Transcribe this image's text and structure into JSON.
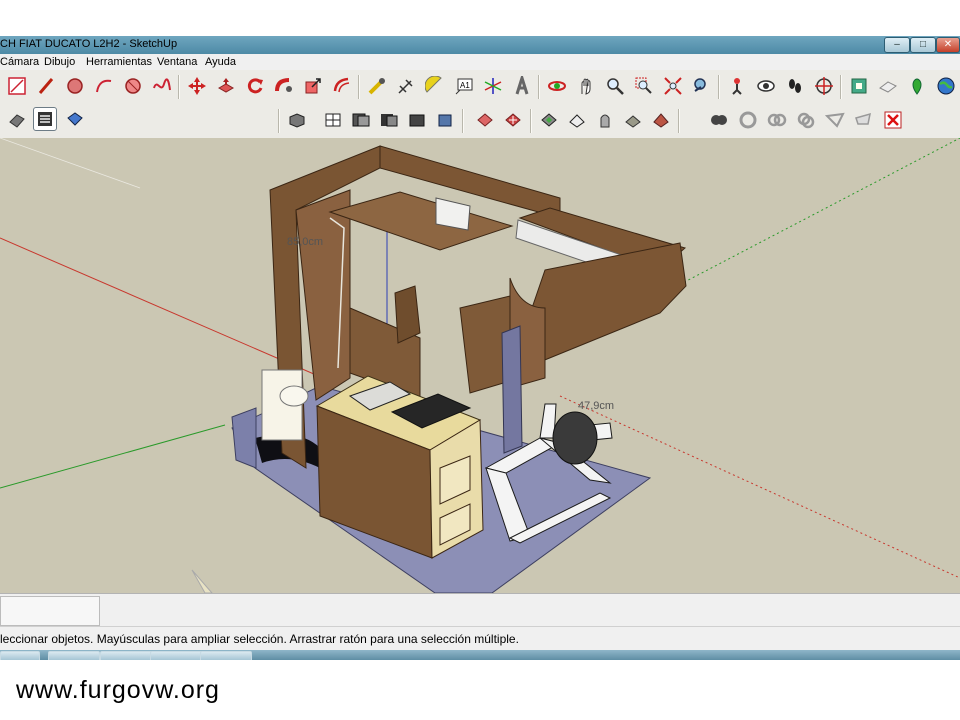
{
  "window": {
    "title": "CH FIAT DUCATO L2H2 - SketchUp",
    "controls": [
      "–",
      "□",
      "✕"
    ]
  },
  "menubar": {
    "items": [
      "Cámara",
      "Dibujo",
      "Herramientas",
      "Ventana",
      "Ayuda"
    ]
  },
  "toolbar_main": {
    "icons": [
      "line-tool-icon",
      "pencil-icon",
      "circle-icon",
      "arc-icon",
      "polygon-icon",
      "freehand-icon",
      "move-icon",
      "push-pull-icon",
      "rotate-icon",
      "follow-me-icon",
      "scale-icon",
      "offset-icon",
      "tape-measure-icon",
      "dimension-icon",
      "protractor-icon",
      "text-icon",
      "axes-icon",
      "3d-text-icon",
      "orbit-icon",
      "pan-icon",
      "zoom-icon",
      "zoom-window-icon",
      "zoom-extents-icon",
      "position-camera-icon",
      "look-around-icon",
      "walk-icon",
      "section-plane-icon",
      "warehouse-icon",
      "sandbox-icon",
      "add-location-icon",
      "toggle-terrain-icon",
      "google-earth-icon"
    ]
  },
  "toolbar_secondary": {
    "icons": [
      "select-icon",
      "component-icon",
      "paint-bucket-icon",
      "iso-view-icon",
      "top-view-icon",
      "front-view-icon",
      "right-view-icon",
      "back-view-icon",
      "left-view-icon",
      "section-cut-icon",
      "section-fill-icon",
      "xray-icon",
      "wireframe-icon",
      "hidden-line-icon",
      "shaded-icon",
      "shaded-texture-icon",
      "monochrome-icon",
      "union-icon",
      "intersect-icon",
      "subtract-icon",
      "trim-icon",
      "split-icon",
      "outer-shell-icon",
      "fold-icon",
      "drape-icon",
      "delete-icon"
    ]
  },
  "viewport": {
    "labels": [
      "85,0cm",
      "47,9cm"
    ],
    "background": "#cbc7b3"
  },
  "status": {
    "text": "leccionar objetos. Mayúsculas para ampliar selección. Arrastrar ratón para una selección múltiple."
  },
  "watermark": "www.furgovw.org"
}
